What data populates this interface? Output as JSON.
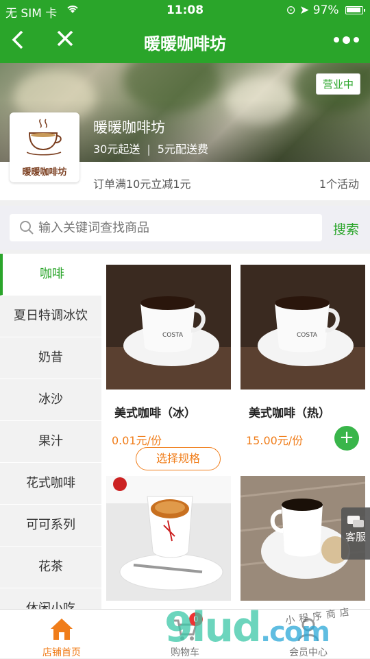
{
  "status_bar": {
    "carrier": "无 SIM 卡",
    "time": "11:08",
    "battery": "97%"
  },
  "nav": {
    "title": "暖暖咖啡坊"
  },
  "store": {
    "name": "暖暖咖啡坊",
    "logo_text": "暖暖咖啡坊",
    "status": "营业中",
    "min_order": "30元起送",
    "delivery_fee": "5元配送费",
    "promo": "订单满10元立减1元",
    "activities": "1个活动"
  },
  "search": {
    "placeholder": "输入关键词查找商品",
    "button": "搜索"
  },
  "categories": [
    "咖啡",
    "夏日特调冰饮",
    "奶昔",
    "冰沙",
    "果汁",
    "花式咖啡",
    "可可系列",
    "花茶",
    "休闲小吃"
  ],
  "products": [
    {
      "name": "美式咖啡（冰）",
      "price": "0.01元/份",
      "action": "选择规格"
    },
    {
      "name": "美式咖啡（热）",
      "price": "15.00元/份"
    }
  ],
  "service": "客服",
  "tabbar": {
    "home": "店铺首页",
    "cart": "购物车",
    "cart_count": "0",
    "member": "会员中心"
  },
  "watermark": {
    "main": "9lud",
    "suffix": ".com",
    "sub": "小程序商店"
  }
}
